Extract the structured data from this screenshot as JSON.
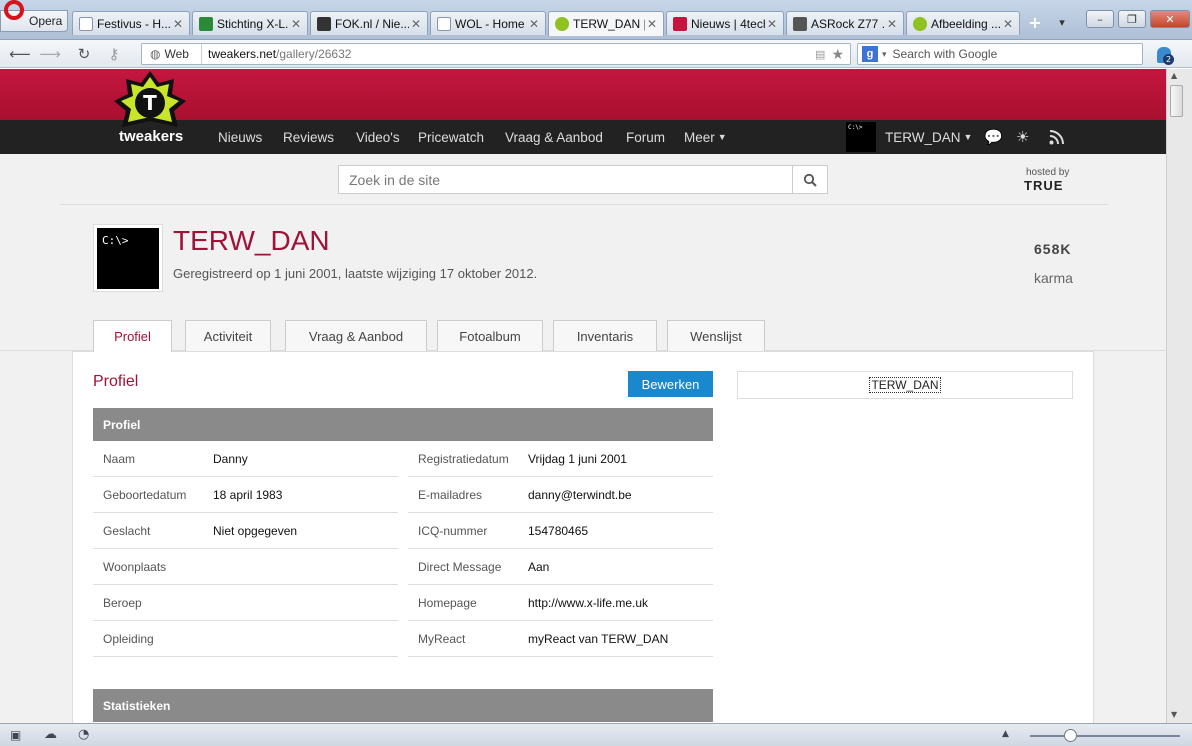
{
  "browser": {
    "opera_label": "Opera",
    "tabs": [
      {
        "label": "Festivus - H...",
        "fav_color": "#cfd6e0",
        "fav": "doc"
      },
      {
        "label": "Stichting X-L...",
        "fav_color": "#2a8a3a",
        "fav": "palm"
      },
      {
        "label": "FOK.nl / Nie...",
        "fav_color": "#333333",
        "fav": "fok"
      },
      {
        "label": "WOL - Home",
        "fav_color": "#cfd6e0",
        "fav": "doc"
      },
      {
        "label": "TERW_DAN |...",
        "fav_color": "#8fc11f",
        "fav": "tweakers"
      },
      {
        "label": "Nieuws | 4tech",
        "fav_color": "#c4163f",
        "fav": "4t"
      },
      {
        "label": "ASRock Z77 ...",
        "fav_color": "#555555",
        "fav": "wrench"
      },
      {
        "label": "Afbeelding ...",
        "fav_color": "#8fc11f",
        "fav": "tweakers"
      }
    ],
    "active_tab": 4,
    "web_label": "Web",
    "url_domain": "tweakers.net",
    "url_path": "/gallery/26632",
    "search_placeholder": "Search with Google",
    "badge": "2"
  },
  "site": {
    "logo_text": "tweakers",
    "nav": [
      "Nieuws",
      "Reviews",
      "Video's",
      "Pricewatch",
      "Vraag & Aanbod",
      "Forum",
      "Meer"
    ],
    "user_name": "TERW_DAN",
    "search_placeholder": "Zoek in de site",
    "hosted_by": "hosted by",
    "hosted_brand": "TRUE"
  },
  "profile": {
    "avatar_text": "C:\\>",
    "name": "TERW_DAN",
    "subtitle": "Geregistreerd op 1 juni 2001, laatste wijziging 17 oktober 2012.",
    "karma_value": "658K",
    "karma_label": "karma",
    "tabs": [
      "Profiel",
      "Activiteit",
      "Vraag & Aanbod",
      "Fotoalbum",
      "Inventaris",
      "Wenslijst"
    ],
    "section_title": "Profiel",
    "edit_button": "Bewerken",
    "table_header": "Profiel",
    "left_rows": [
      {
        "k": "Naam",
        "v": "Danny"
      },
      {
        "k": "Geboortedatum",
        "v": "18 april 1983"
      },
      {
        "k": "Geslacht",
        "v": "Niet opgegeven"
      },
      {
        "k": "Woonplaats",
        "v": ""
      },
      {
        "k": "Beroep",
        "v": ""
      },
      {
        "k": "Opleiding",
        "v": ""
      }
    ],
    "right_rows": [
      {
        "k": "Registratiedatum",
        "v": "Vrijdag 1 juni 2001"
      },
      {
        "k": "E-mailadres",
        "v": "danny@terwindt.be"
      },
      {
        "k": "ICQ-nummer",
        "v": "154780465"
      },
      {
        "k": "Direct Message",
        "v": "Aan"
      },
      {
        "k": "Homepage",
        "v": "http://www.x-life.me.uk"
      },
      {
        "k": "MyReact",
        "v": "myReact van TERW_DAN"
      }
    ],
    "stats_header": "Statistieken",
    "side_box_text": "TERW_DAN"
  },
  "colors": {
    "brand_red": "#b3123a",
    "link_blue": "#0a3a66",
    "button_blue": "#1a88cc"
  }
}
